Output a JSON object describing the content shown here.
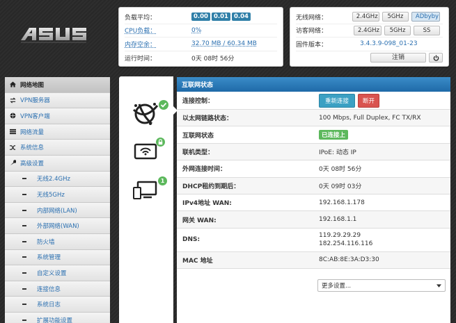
{
  "brand": {
    "logo_text": "ASUS"
  },
  "status": {
    "load_label": "负载平均：",
    "load_values": [
      "0.00",
      "0.01",
      "0.04"
    ],
    "cpu_label": "CPU负载：",
    "cpu_value": "0%",
    "mem_label": "内存空余：",
    "mem_value": "32.70 MB / 60.34 MB",
    "uptime_label": "运行时间：",
    "uptime_value": "0天 08时 56分"
  },
  "wifi": {
    "wireless_label": "无线网络：",
    "wireless_buttons": [
      "2.4GHz",
      "5GHz",
      "ADbyby"
    ],
    "guest_label": "访客网络：",
    "guest_buttons": [
      "2.4GHz",
      "5GHz",
      "SS"
    ],
    "firmware_label": "固件版本：",
    "firmware_value": "3.4.3.9-098_01-23",
    "logout_label": "注销"
  },
  "nav": {
    "items": [
      {
        "label": "网络地图",
        "icon": "home-icon"
      },
      {
        "label": "VPN服务器",
        "icon": "refresh-icon"
      },
      {
        "label": "VPN客户端",
        "icon": "globe-icon"
      },
      {
        "label": "网络流量",
        "icon": "list-icon"
      },
      {
        "label": "系统信息",
        "icon": "shuffle-icon"
      },
      {
        "label": "高级设置",
        "icon": "wrench-icon"
      }
    ],
    "sub_items": [
      "无线2.4GHz",
      "无线5GHz",
      "内部网络(LAN)",
      "外部网络(WAN)",
      "防火墙",
      "系统管理",
      "自定义设置",
      "连接信息",
      "系统日志",
      "扩展功能设置"
    ]
  },
  "icons": {
    "badge_two": "1"
  },
  "main": {
    "title": "互联网状态",
    "control_label": "连接控制：",
    "connect_label": "重新连接",
    "disconnect_label": "断开",
    "rows": [
      {
        "label": "以太网链路状态：",
        "value": "100 Mbps, Full Duplex, FC TX/RX"
      },
      {
        "label": "互联网状态",
        "value": "已连接上",
        "badge": true
      },
      {
        "label": "联机类型：",
        "value": "IPoE: 动态 IP"
      },
      {
        "label": "外网连接时间：",
        "value": "0天 08时 56分"
      },
      {
        "label": "DHCP租约到期后：",
        "value": "0天 09时 03分"
      },
      {
        "label": "IPv4地址 WAN:",
        "value": "192.168.1.178"
      },
      {
        "label": "网关 WAN:",
        "value": "192.168.1.1"
      }
    ],
    "dns_label": "DNS:",
    "dns_values": [
      "119.29.29.29",
      "182.254.116.116"
    ],
    "mac_label": "MAC 地址",
    "mac_value": "8C:AB:8E:3A:D3:30",
    "more_settings": "更多设置..."
  },
  "colors": {
    "accent": "#2a6fb0",
    "header": "#1f6aa8",
    "connect": "#3ba0c3",
    "disconnect": "#d9534f",
    "connected": "#5cb85c"
  }
}
